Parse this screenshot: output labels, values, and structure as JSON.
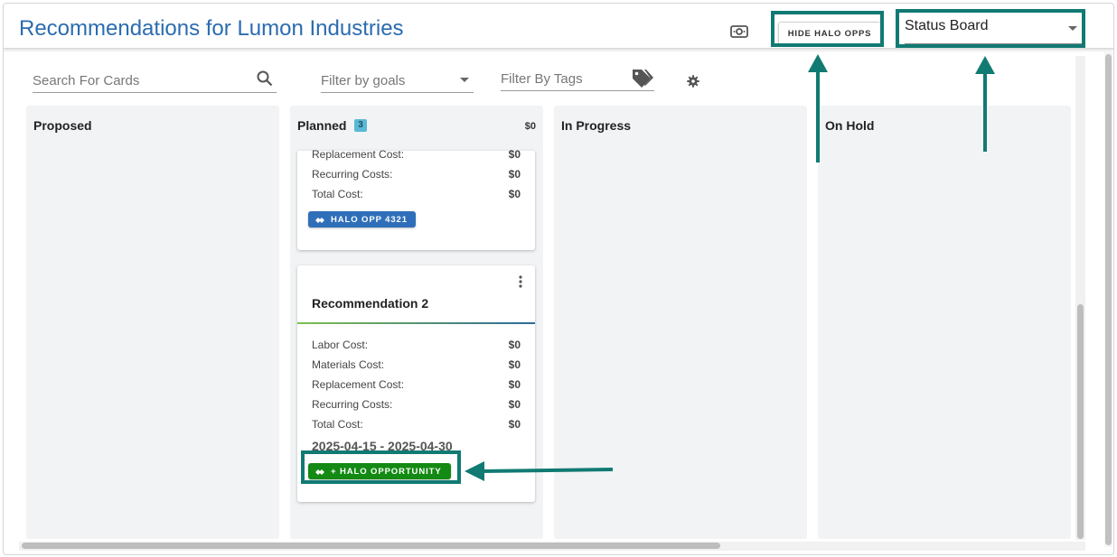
{
  "header": {
    "title": "Recommendations for Lumon Industries",
    "hide_button": "HIDE HALO OPPS",
    "board_select": "Status Board",
    "money_icon": "money-icon"
  },
  "filters": {
    "search_placeholder": "Search For Cards",
    "goals_placeholder": "Filter by goals",
    "tags_placeholder": "Filter By Tags"
  },
  "columns": [
    {
      "title": "Proposed"
    },
    {
      "title": "Planned",
      "count": "3",
      "total": "$0"
    },
    {
      "title": "In Progress"
    },
    {
      "title": "On Hold"
    }
  ],
  "cards": {
    "card1": {
      "rows": [
        {
          "label": "Replacement Cost:",
          "amount": "$0"
        },
        {
          "label": "Recurring Costs:",
          "amount": "$0"
        },
        {
          "label": "Total Cost:",
          "amount": "$0"
        }
      ],
      "opp_button": "HALO OPP 4321"
    },
    "card2": {
      "title": "Recommendation 2",
      "rows": [
        {
          "label": "Labor Cost:",
          "amount": "$0"
        },
        {
          "label": "Materials Cost:",
          "amount": "$0"
        },
        {
          "label": "Replacement Cost:",
          "amount": "$0"
        },
        {
          "label": "Recurring Costs:",
          "amount": "$0"
        },
        {
          "label": "Total Cost:",
          "amount": "$0"
        }
      ],
      "dates": "2025-04-15 - 2025-04-30",
      "opp_button": "+ HALO OPPORTUNITY"
    }
  },
  "colors": {
    "title_blue": "#2b6cb0",
    "callout_teal": "#117a73",
    "opp_blue": "#2f6fba",
    "opp_green": "#138a13",
    "badge": "#5bb8d6"
  }
}
